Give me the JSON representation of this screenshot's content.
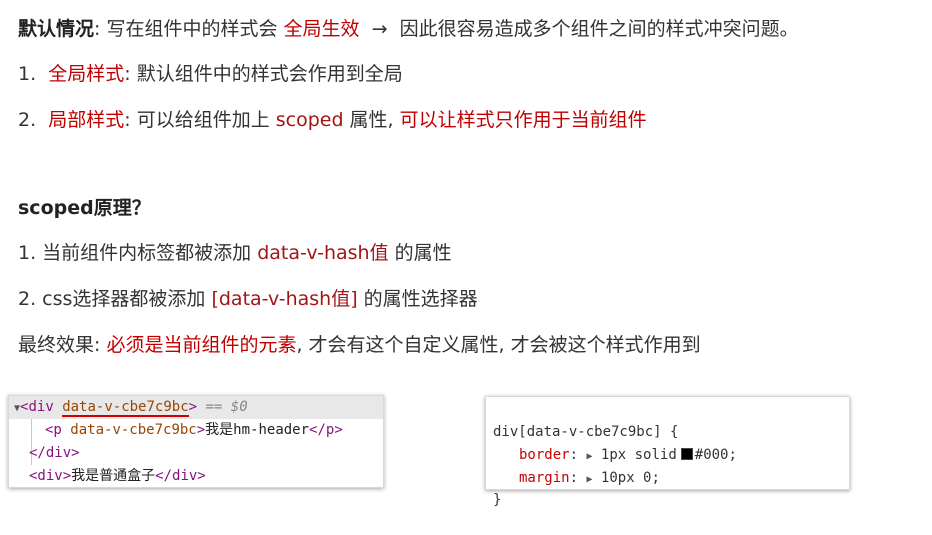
{
  "intro": {
    "label": "默认情况",
    "sep": ": 写在组件中的样式会 ",
    "highlight": "全局生效",
    "arrow": "→",
    "rest": "因此很容易造成多个组件之间的样式冲突问题。"
  },
  "items": [
    {
      "num": "1.",
      "label": "全局样式",
      "rest": ": 默认组件中的样式会作用到全局"
    },
    {
      "num": "2.",
      "label": "局部样式",
      "mid": ": 可以给组件加上 ",
      "code": "scoped",
      "mid2": " 属性, ",
      "tail": "可以让样式只作用于当前组件"
    }
  ],
  "principle": {
    "heading": "scoped原理？",
    "p1_pre": "1. 当前组件内标签都被添加 ",
    "p1_hl": "data-v-hash值",
    "p1_post": " 的属性",
    "p2_pre": "2. css选择器都被添加 ",
    "p2_hl": "[data-v-hash值]",
    "p2_post": " 的属性选择器",
    "effect_pre": "最终效果: ",
    "effect_hl": "必须是当前组件的元素",
    "effect_post": ", 才会有这个自定义属性, 才会被这个样式作用到"
  },
  "dom_panel": {
    "row1_open": "<div ",
    "row1_attr": "data-v-cbe7c9bc",
    "row1_close": ">",
    "row1_eq": " == $0",
    "row2_open": "<p ",
    "row2_attr": "data-v-cbe7c9bc",
    "row2_close": ">",
    "row2_text": "我是hm-header",
    "row2_end": "</p>",
    "row3": "</div>",
    "row4_open": "<div>",
    "row4_text": "我是普通盒子",
    "row4_end": "</div>"
  },
  "css_panel": {
    "selector": "div[data-v-cbe7c9bc] {",
    "prop1": "border",
    "val1a": "1px solid",
    "val1b": "#000;",
    "prop2": "margin",
    "val2": "10px 0;",
    "close": "}"
  },
  "colors": {
    "highlight": "#c00000",
    "swatch": "#000000"
  }
}
